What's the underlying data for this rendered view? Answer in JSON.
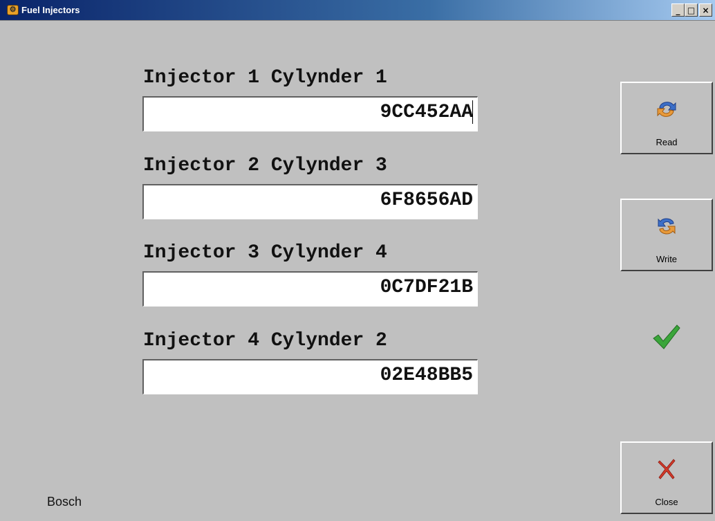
{
  "window": {
    "title": "Fuel Injectors",
    "app_icon": "engine-icon",
    "buttons": {
      "minimize": "_",
      "maximize": "□",
      "close": "×"
    }
  },
  "injectors": [
    {
      "label": "Injector 1 Cylynder 1",
      "code": "9CC452AA"
    },
    {
      "label": "Injector 2 Cylynder 3",
      "code": "6F8656AD"
    },
    {
      "label": "Injector 3 Cylynder 4",
      "code": "0C7DF21B"
    },
    {
      "label": "Injector 4 Cylynder 2",
      "code": "02E48BB5"
    }
  ],
  "actions": {
    "read_label": "Read",
    "write_label": "Write",
    "close_label": "Close"
  },
  "status": {
    "icon": "check-icon",
    "color": "#3aa53a"
  },
  "footer": {
    "brand": "Bosch"
  }
}
